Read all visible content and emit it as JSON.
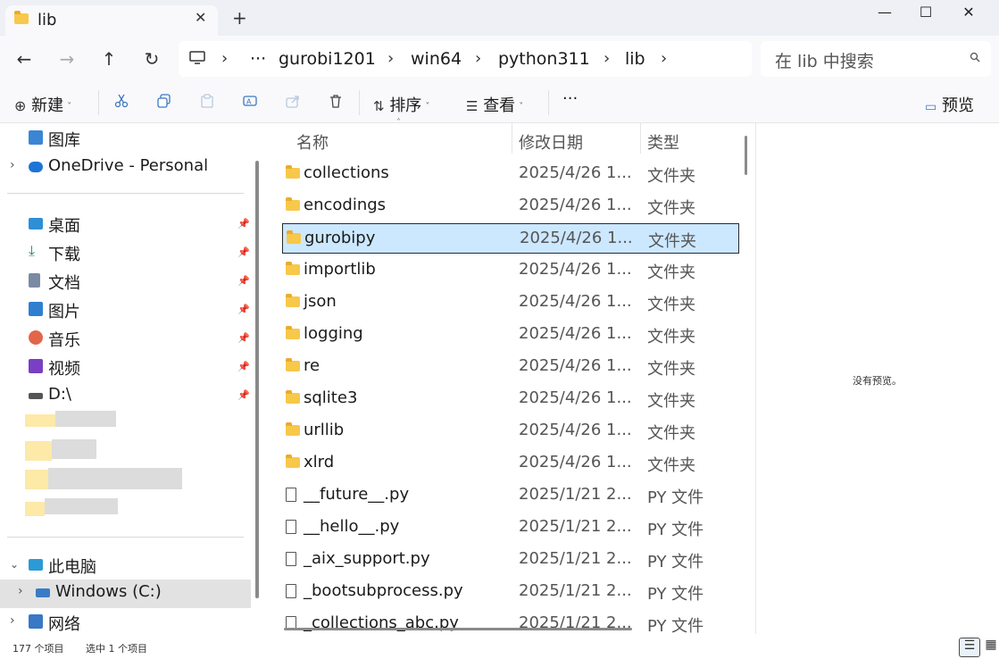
{
  "window": {
    "tab_title": "lib",
    "tab_close": "✕",
    "new_tab": "+",
    "minimize": "—",
    "maximize": "☐",
    "close": "✕"
  },
  "nav": {
    "back_icon": "←",
    "forward_icon": "→",
    "up_icon": "↑",
    "refresh_icon": "↻",
    "breadcrumb": {
      "ellipsis": "···",
      "segments": [
        "gurobi1201",
        "win64",
        "python311",
        "lib"
      ],
      "sep": "›"
    },
    "search_placeholder": "在 lib 中搜索"
  },
  "toolbar": {
    "new_label": "新建",
    "sort_label": "排序",
    "view_label": "查看",
    "more_label": "···",
    "preview_label": "预览"
  },
  "sidebar": {
    "top_items": [
      {
        "label": "图库",
        "icon": "gallery-icon"
      },
      {
        "label": "OneDrive - Personal",
        "icon": "cloud-icon"
      }
    ],
    "pinned_items": [
      {
        "label": "桌面",
        "icon": "desktop-icon"
      },
      {
        "label": "下载",
        "icon": "download-icon"
      },
      {
        "label": "文档",
        "icon": "document-icon"
      },
      {
        "label": "图片",
        "icon": "pictures-icon"
      },
      {
        "label": "音乐",
        "icon": "music-icon"
      },
      {
        "label": "视频",
        "icon": "video-icon"
      },
      {
        "label": "D:\\",
        "icon": "drive-icon"
      }
    ],
    "this_pc": "此电脑",
    "windows_c": "Windows (C:)",
    "network": "网络"
  },
  "columns": {
    "name": "名称",
    "date": "修改日期",
    "type": "类型"
  },
  "files": [
    {
      "name": "collections",
      "date": "2025/4/26 1...",
      "type": "文件夹",
      "kind": "folder"
    },
    {
      "name": "encodings",
      "date": "2025/4/26 1...",
      "type": "文件夹",
      "kind": "folder"
    },
    {
      "name": "gurobipy",
      "date": "2025/4/26 1...",
      "type": "文件夹",
      "kind": "folder",
      "selected": true
    },
    {
      "name": "importlib",
      "date": "2025/4/26 1...",
      "type": "文件夹",
      "kind": "folder"
    },
    {
      "name": "json",
      "date": "2025/4/26 1...",
      "type": "文件夹",
      "kind": "folder"
    },
    {
      "name": "logging",
      "date": "2025/4/26 1...",
      "type": "文件夹",
      "kind": "folder"
    },
    {
      "name": "re",
      "date": "2025/4/26 1...",
      "type": "文件夹",
      "kind": "folder"
    },
    {
      "name": "sqlite3",
      "date": "2025/4/26 1...",
      "type": "文件夹",
      "kind": "folder"
    },
    {
      "name": "urllib",
      "date": "2025/4/26 1...",
      "type": "文件夹",
      "kind": "folder"
    },
    {
      "name": "xlrd",
      "date": "2025/4/26 1...",
      "type": "文件夹",
      "kind": "folder"
    },
    {
      "name": "__future__.py",
      "date": "2025/1/21 2...",
      "type": "PY 文件",
      "kind": "file"
    },
    {
      "name": "__hello__.py",
      "date": "2025/1/21 2...",
      "type": "PY 文件",
      "kind": "file"
    },
    {
      "name": "_aix_support.py",
      "date": "2025/1/21 2...",
      "type": "PY 文件",
      "kind": "file"
    },
    {
      "name": "_bootsubprocess.py",
      "date": "2025/1/21 2...",
      "type": "PY 文件",
      "kind": "file"
    },
    {
      "name": "_collections_abc.py",
      "date": "2025/1/21 2...",
      "type": "PY 文件",
      "kind": "file"
    }
  ],
  "preview": {
    "message": "没有预览。"
  },
  "status": {
    "count": "177 个项目",
    "selected": "选中 1 个项目"
  }
}
